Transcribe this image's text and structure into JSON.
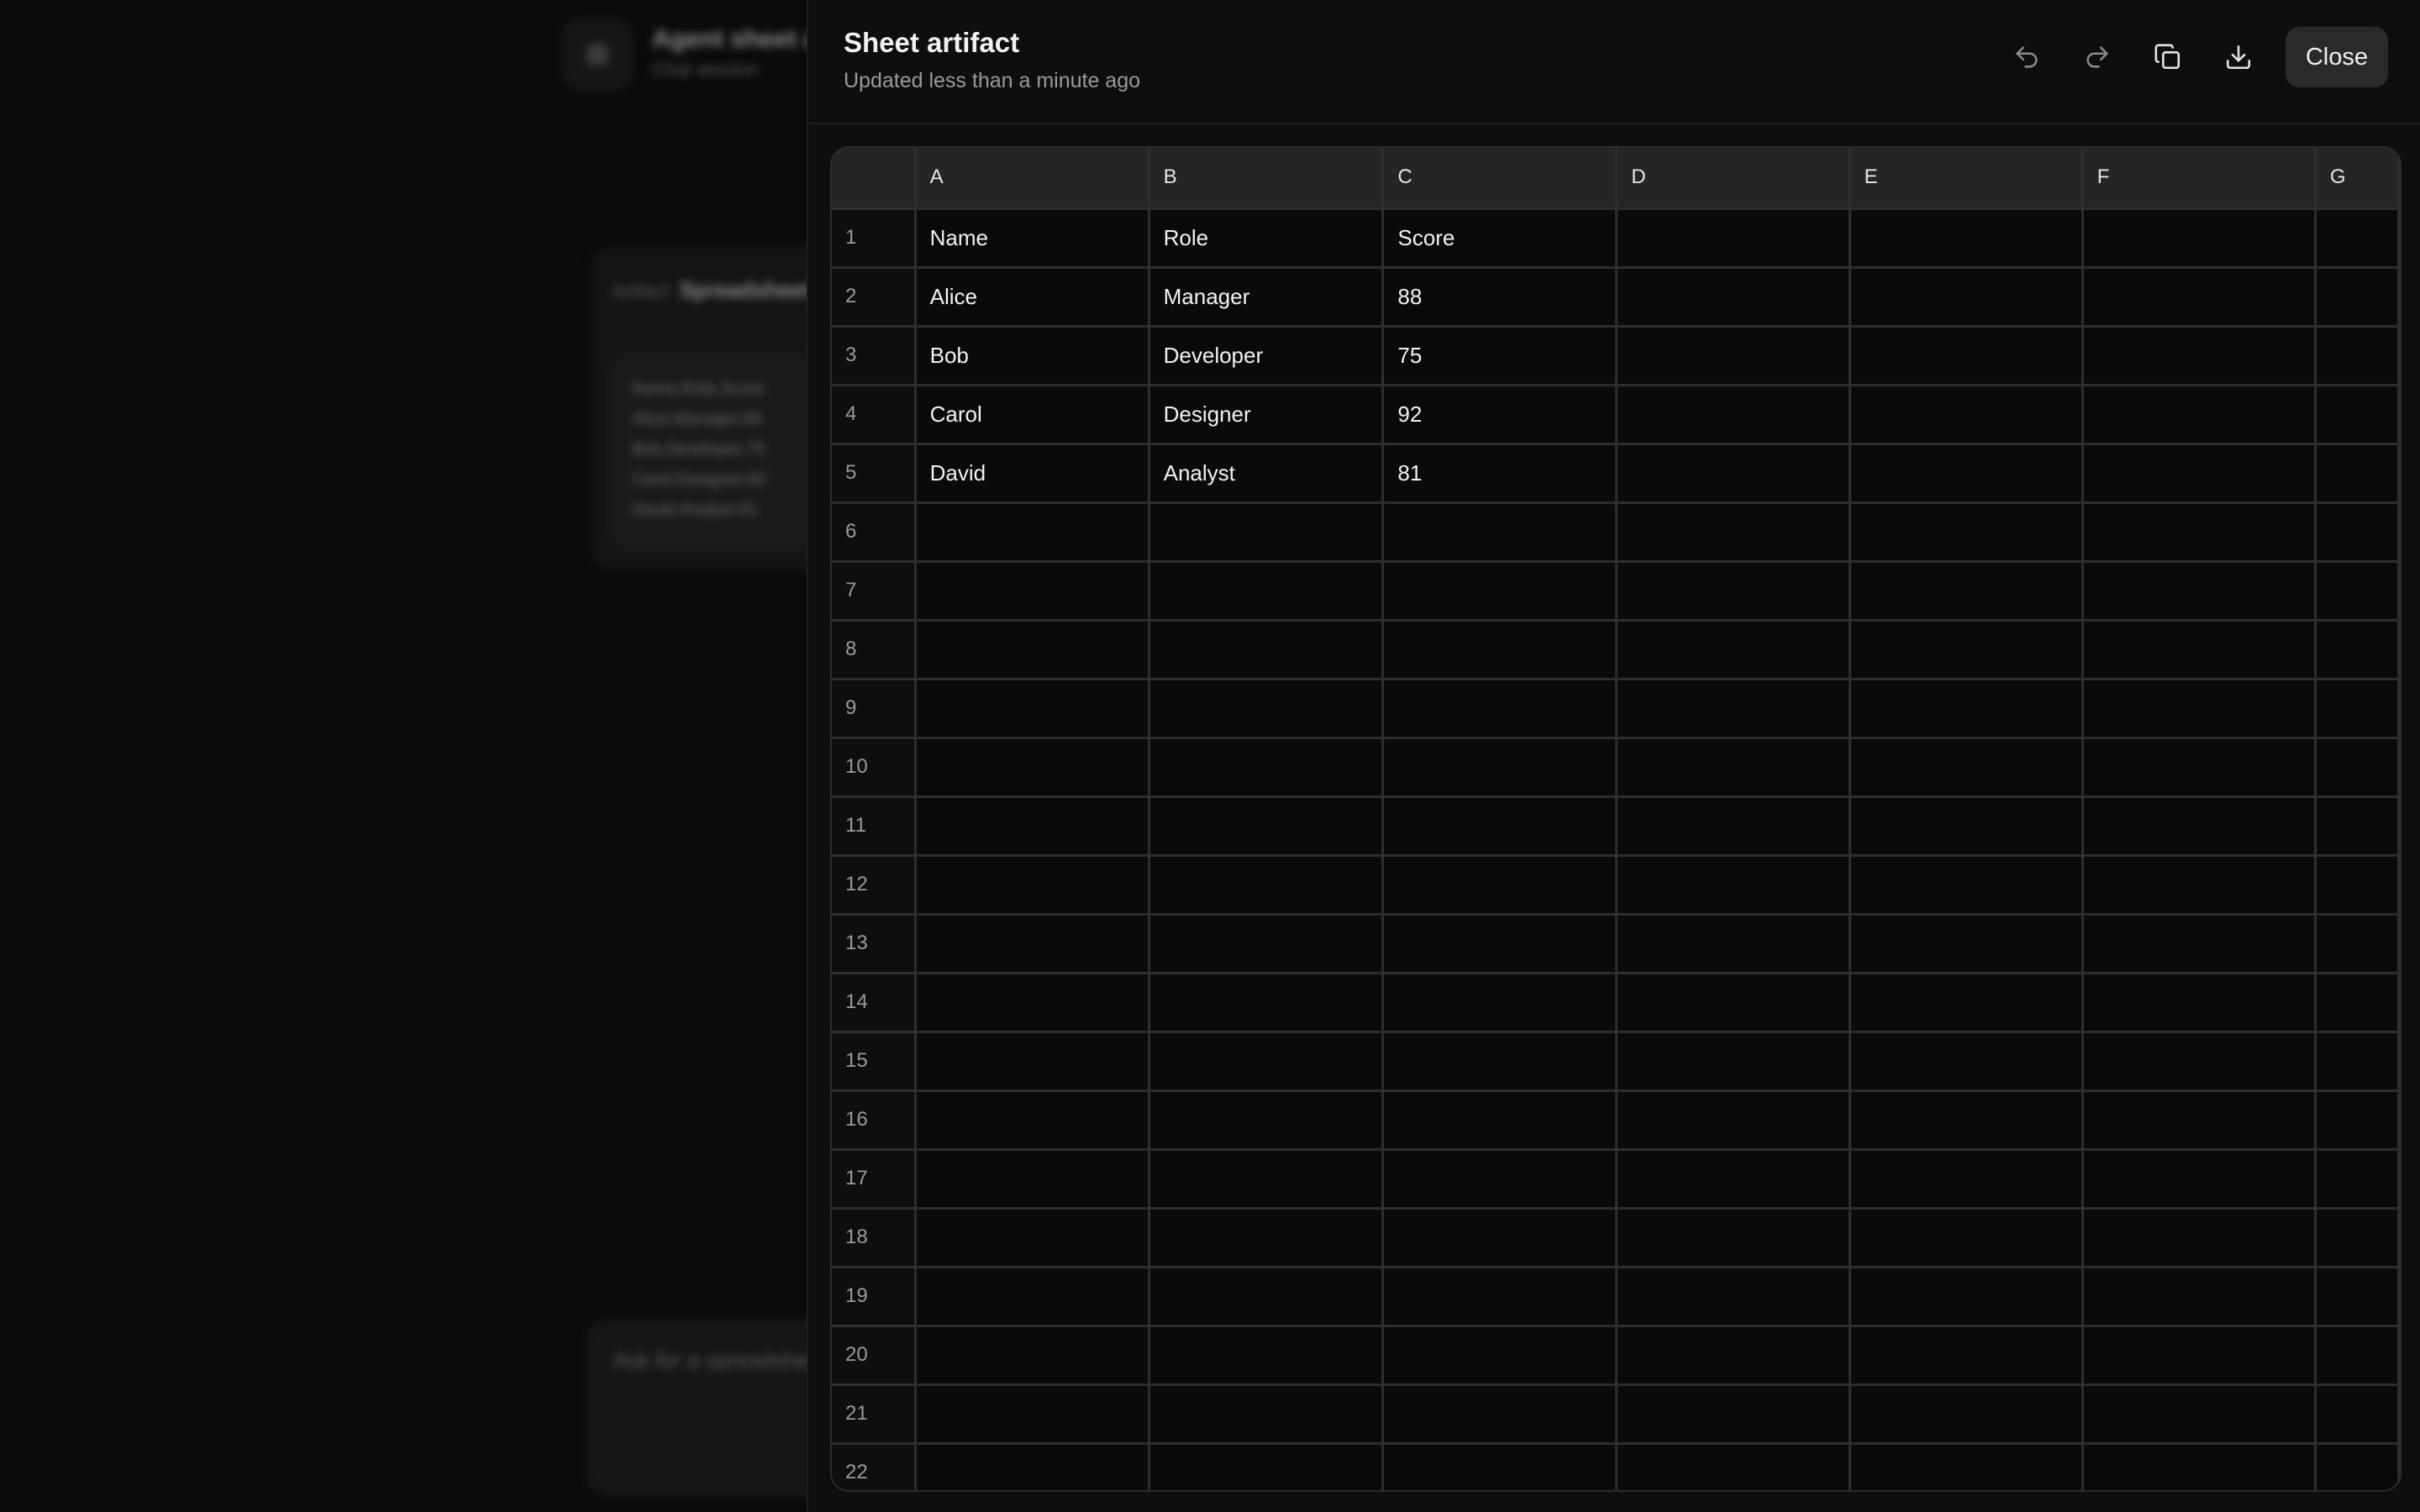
{
  "background": {
    "header_title": "Agent sheet artifact",
    "header_subtitle": "Chat session",
    "card_meta": "Artifact",
    "card_title": "Spreadsheet",
    "card_lines": [
      "Name,Role,Score",
      "Alice,Manager,88",
      "Bob,Developer,75",
      "Carol,Designer,92",
      "David,Analyst,81"
    ],
    "composer_placeholder": "Ask for a spreadsheet"
  },
  "panel": {
    "title": "Sheet artifact",
    "subtitle": "Updated less than a minute ago",
    "toolbar": {
      "undo_icon": "undo-icon",
      "redo_icon": "redo-icon",
      "copy_icon": "copy-icon",
      "download_icon": "download-icon",
      "close_label": "Close"
    }
  },
  "sheet": {
    "columns": [
      "A",
      "B",
      "C",
      "D",
      "E",
      "F",
      "G"
    ],
    "row_count": 22,
    "rows": [
      [
        "Name",
        "Role",
        "Score",
        "",
        "",
        "",
        ""
      ],
      [
        "Alice",
        "Manager",
        "88",
        "",
        "",
        "",
        ""
      ],
      [
        "Bob",
        "Developer",
        "75",
        "",
        "",
        "",
        ""
      ],
      [
        "Carol",
        "Designer",
        "92",
        "",
        "",
        "",
        ""
      ],
      [
        "David",
        "Analyst",
        "81",
        "",
        "",
        "",
        ""
      ]
    ]
  },
  "colors": {
    "background": "#0b0b0b",
    "panel": "#0e0e0e",
    "header_cells": "#252525",
    "grid_lines": "#2e2e2e",
    "close_button": "#2a2a2a"
  }
}
